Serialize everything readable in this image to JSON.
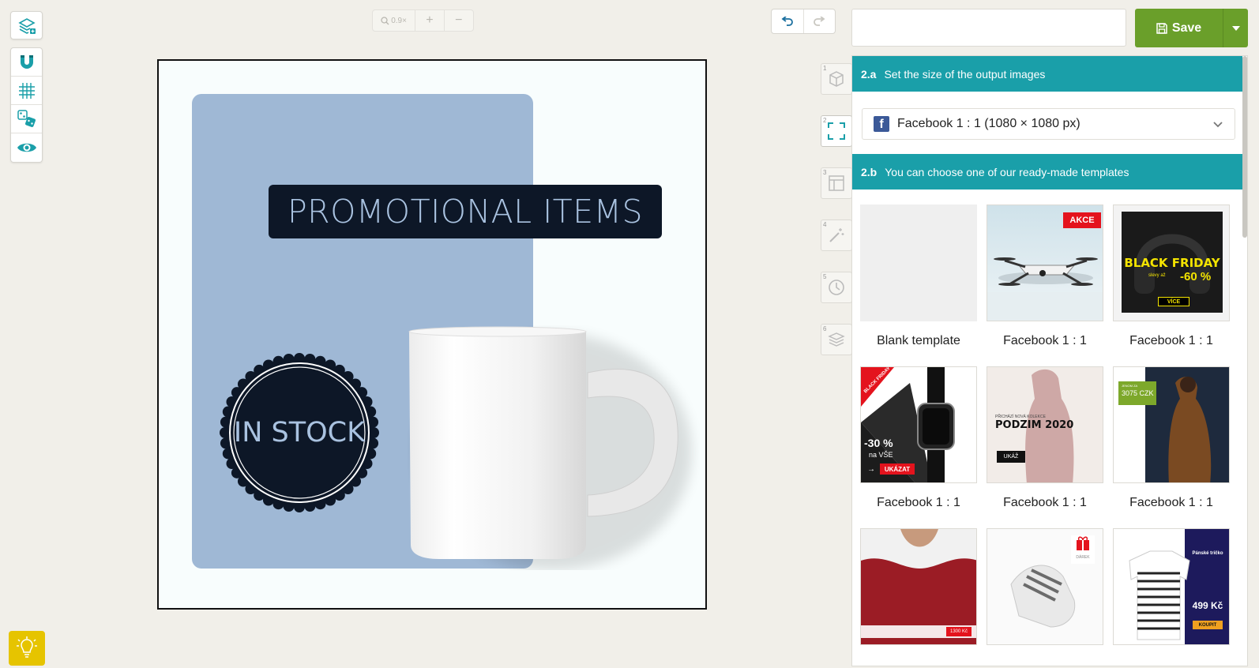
{
  "toolbar": {
    "tools": [
      {
        "name": "layers-add-icon"
      },
      {
        "name": "magnet-icon"
      },
      {
        "name": "grid-icon"
      },
      {
        "name": "dice-icon"
      },
      {
        "name": "eye-icon"
      }
    ]
  },
  "zoom": {
    "level": "0.9×",
    "plus": "+",
    "minus": "−"
  },
  "document_name": {
    "value": "",
    "placeholder": ""
  },
  "save": {
    "label": "Save"
  },
  "canvas": {
    "promo_text": "PROMOTIONAL ITEMS",
    "badge_text": "IN STOCK",
    "colors": {
      "blue_block": "#9fb8d5",
      "navy": "#0d1727",
      "text_light": "#a9c2e0"
    }
  },
  "steps": [
    {
      "num": "1",
      "icon": "cube-icon"
    },
    {
      "num": "2",
      "icon": "resize-icon"
    },
    {
      "num": "3",
      "icon": "layout-icon"
    },
    {
      "num": "4",
      "icon": "magic-wand-icon"
    },
    {
      "num": "5",
      "icon": "clock-icon"
    },
    {
      "num": "6",
      "icon": "layers-icon"
    }
  ],
  "panel": {
    "section_a": {
      "num": "2.a",
      "title": "Set the size of the output images"
    },
    "size_select": {
      "value": "Facebook 1 : 1 (1080 × 1080 px)"
    },
    "section_b": {
      "num": "2.b",
      "title": "You can choose one of our ready-made templates"
    },
    "templates": [
      {
        "label": "Blank template"
      },
      {
        "label": "Facebook 1 : 1",
        "badge": "AKCE"
      },
      {
        "label": "Facebook 1 : 1",
        "headline": "BLACK FRIDAY",
        "sub": "slevy až",
        "pct": "-60 %",
        "cta": "VÍCE"
      },
      {
        "label": "Facebook 1 : 1",
        "corner": "BLACK FRIDAY",
        "pct": "-30 %",
        "sub": "na VŠE",
        "cta": "UKÁZAT"
      },
      {
        "label": "Facebook 1 : 1",
        "kicker": "PŘICHÁZÍ NOVÁ KOLEKCE",
        "headline": "PODZIM 2020",
        "cta": "UKÁŽ"
      },
      {
        "label": "Facebook 1 : 1",
        "kicker": "JENOM ZA",
        "price": "3075 CZK"
      },
      {
        "price": "1300 Kč"
      },
      {
        "badge": "DÁREK"
      },
      {
        "title": "Pánské tričko",
        "price": "499 Kč",
        "cta": "KOUPIT"
      }
    ]
  }
}
